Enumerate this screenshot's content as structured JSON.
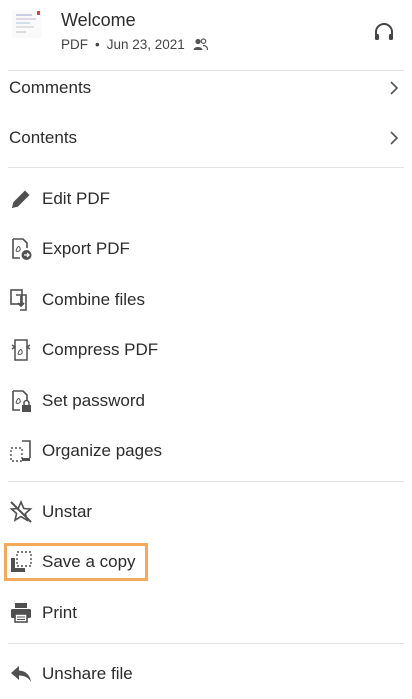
{
  "header": {
    "title": "Welcome",
    "file_type": "PDF",
    "separator": "•",
    "date": "Jun 23, 2021"
  },
  "sections": {
    "comments_label": "Comments",
    "contents_label": "Contents"
  },
  "actions": [
    {
      "label": "Edit PDF",
      "icon": "pencil-icon"
    },
    {
      "label": "Export PDF",
      "icon": "export-pdf-icon"
    },
    {
      "label": "Combine files",
      "icon": "combine-files-icon"
    },
    {
      "label": "Compress PDF",
      "icon": "compress-pdf-icon"
    },
    {
      "label": "Set password",
      "icon": "lock-file-icon"
    },
    {
      "label": "Organize pages",
      "icon": "organize-pages-icon"
    }
  ],
  "more_actions": [
    {
      "label": "Unstar",
      "icon": "unstar-icon"
    },
    {
      "label": "Save a copy",
      "icon": "save-copy-icon",
      "highlighted": true
    },
    {
      "label": "Print",
      "icon": "printer-icon"
    }
  ],
  "share_actions": [
    {
      "label": "Unshare file",
      "icon": "unshare-icon"
    }
  ],
  "colors": {
    "highlight_border": "#f5a95b",
    "icon": "#505050",
    "text": "#2c2c2c",
    "divider": "#e2e2e2"
  }
}
